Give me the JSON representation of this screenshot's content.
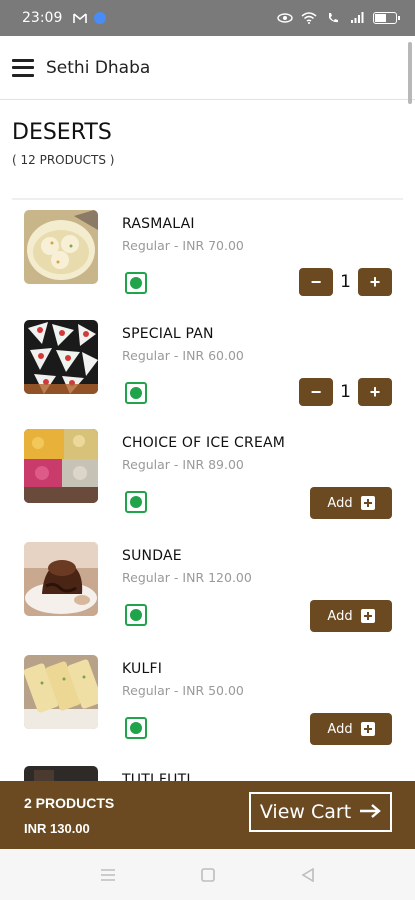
{
  "status_bar": {
    "time": "23:09",
    "icons": [
      "gmail-icon",
      "location-icon",
      "eye-icon",
      "wifi-icon",
      "call-icon",
      "signal-icon",
      "battery-icon"
    ]
  },
  "app_bar": {
    "title": "Sethi Dhaba"
  },
  "category": {
    "name": "DESERTS",
    "count": "( 12 PRODUCTS )"
  },
  "products": [
    {
      "name": "RASMALAI",
      "price": "Regular - INR 70.00",
      "veg": true,
      "quantity": "1",
      "in_cart": true
    },
    {
      "name": "SPECIAL PAN",
      "price": "Regular - INR 60.00",
      "veg": true,
      "quantity": "1",
      "in_cart": true
    },
    {
      "name": "CHOICE OF ICE CREAM",
      "price": "Regular - INR 89.00",
      "veg": true,
      "add_label": "Add",
      "in_cart": false
    },
    {
      "name": "SUNDAE",
      "price": "Regular - INR 120.00",
      "veg": true,
      "add_label": "Add",
      "in_cart": false
    },
    {
      "name": "KULFI",
      "price": "Regular - INR 50.00",
      "veg": true,
      "add_label": "Add",
      "in_cart": false
    },
    {
      "name": "TUTI FUTI",
      "price": "",
      "veg": true,
      "in_cart": false
    }
  ],
  "cart": {
    "count": "2 PRODUCTS",
    "total": "INR 130.00",
    "view_label": "View Cart"
  },
  "colors": {
    "accent": "#6b4a22",
    "veg_green": "#1fa44a",
    "status_bar": "#7a7a7a"
  }
}
